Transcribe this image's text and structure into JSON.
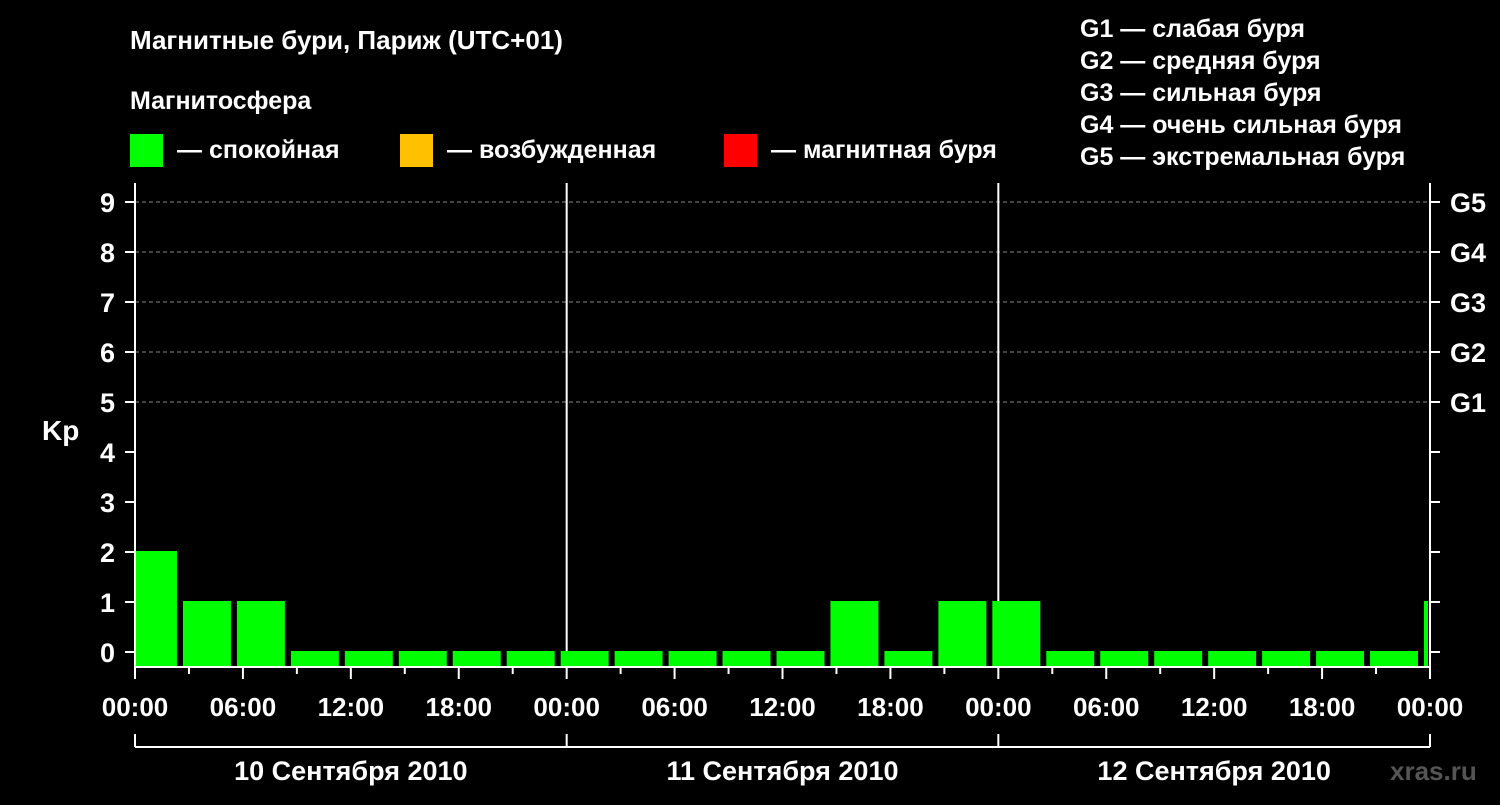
{
  "chart_data": {
    "type": "bar",
    "title": "Магнитные бури, Париж (UTC+01)",
    "ylabel": "Kp",
    "ylim": [
      0,
      9
    ],
    "yticks": [
      "0",
      "1",
      "2",
      "3",
      "4",
      "5",
      "6",
      "7",
      "8",
      "9"
    ],
    "storm_levels": [
      {
        "kp": 5,
        "label": "G1"
      },
      {
        "kp": 6,
        "label": "G2"
      },
      {
        "kp": 7,
        "label": "G3"
      },
      {
        "kp": 8,
        "label": "G4"
      },
      {
        "kp": 9,
        "label": "G5"
      }
    ],
    "xticks": [
      "00:00",
      "06:00",
      "12:00",
      "18:00",
      "00:00",
      "06:00",
      "12:00",
      "18:00",
      "00:00",
      "06:00",
      "12:00",
      "18:00",
      "00:00"
    ],
    "days": [
      "10 Сентября 2010",
      "11 Сентября 2010",
      "12 Сентября 2010"
    ],
    "start_hour": 1,
    "interval_hours": 3,
    "values": [
      2,
      1,
      1,
      0,
      0,
      0,
      0,
      0,
      0,
      0,
      0,
      0,
      0,
      1,
      0,
      1,
      1,
      0,
      0,
      0,
      0,
      0,
      0,
      0,
      1
    ],
    "grid": "dashed at Kp 5-9",
    "colors": {
      "quiet": "#00ff00",
      "excited": "#ffc000",
      "storm": "#ff0000",
      "background": "#000000"
    }
  },
  "legend": {
    "heading": "Магнитосфера",
    "items": [
      {
        "color": "#00ff00",
        "label": "— спокойная"
      },
      {
        "color": "#ffc000",
        "label": "— возбужденная"
      },
      {
        "color": "#ff0000",
        "label": "— магнитная буря"
      }
    ]
  },
  "storm_legend": [
    "G1 — слабая буря",
    "G2 — средняя буря",
    "G3 — сильная буря",
    "G4 — очень сильная буря",
    "G5 — экстремальная буря"
  ],
  "watermark": "xras.ru"
}
